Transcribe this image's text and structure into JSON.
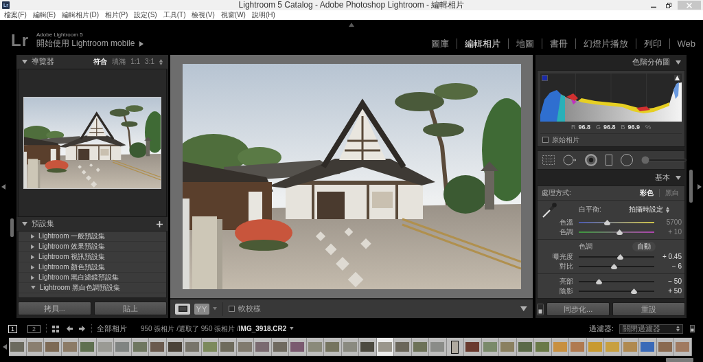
{
  "window": {
    "app_icon": "Lr",
    "title": "Lightroom 5 Catalog - Adobe Photoshop Lightroom - 編輯相片"
  },
  "menu": [
    "檔案(F)",
    "編輯(E)",
    "編輯相片(D)",
    "相片(P)",
    "設定(S)",
    "工具(T)",
    "檢視(V)",
    "視窗(W)",
    "說明(H)"
  ],
  "identity": {
    "logo": "Lr",
    "product": "Adobe Lightroom 5",
    "promo": "開始使用 Lightroom mobile"
  },
  "modules": [
    {
      "label": "圖庫",
      "selected": false
    },
    {
      "label": "編輯相片",
      "selected": true
    },
    {
      "label": "地圖",
      "selected": false
    },
    {
      "label": "書冊",
      "selected": false
    },
    {
      "label": "幻燈片播放",
      "selected": false
    },
    {
      "label": "列印",
      "selected": false
    },
    {
      "label": "Web",
      "selected": false
    }
  ],
  "navigator": {
    "title": "導覽器",
    "expanded": true,
    "zoom_options": [
      {
        "label": "符合",
        "selected": true
      },
      {
        "label": "填滿",
        "selected": false
      },
      {
        "label": "1:1",
        "selected": false
      },
      {
        "label": "3:1",
        "selected": false
      }
    ]
  },
  "presets": {
    "title": "預設集",
    "expanded": true,
    "items": [
      {
        "label": "Lightroom 一般預設集",
        "expanded": false
      },
      {
        "label": "Lightroom 效果預設集",
        "expanded": false
      },
      {
        "label": "Lightroom 視訊預設集",
        "expanded": false
      },
      {
        "label": "Lightroom 顏色預設集",
        "expanded": false
      },
      {
        "label": "Lightroom 黑白濾鏡預設集",
        "expanded": false
      },
      {
        "label": "Lightroom 黑白色調預設集",
        "expanded": true
      }
    ]
  },
  "left_buttons": [
    "拷貝...",
    "貼上"
  ],
  "toolbar": {
    "compare": "YY",
    "soft_proofing": {
      "label": "軟校樣",
      "checked": false
    }
  },
  "histogram": {
    "title": "色階分佈圖",
    "expanded": true,
    "readout": [
      {
        "label": "R",
        "value": "96.8"
      },
      {
        "label": "G",
        "value": "96.8"
      },
      {
        "label": "B",
        "value": "96.9"
      }
    ],
    "unit": "%",
    "original_photo": {
      "label": "原始相片",
      "checked": false
    }
  },
  "basic": {
    "title": "基本",
    "expanded": true,
    "treatment": {
      "label": "處理方式:",
      "options": [
        {
          "label": "彩色",
          "selected": true
        },
        {
          "label": "黑白",
          "selected": false
        }
      ]
    },
    "white_balance": {
      "label": "白平衡:",
      "value": "拍攝時設定"
    },
    "wb_sliders": [
      {
        "label": "色溫",
        "kind": "temperature",
        "level": 0.38,
        "reading": "5700"
      },
      {
        "label": "色調",
        "kind": "tint",
        "level": 0.54,
        "reading": "+ 10"
      }
    ],
    "tone": {
      "label": "色調",
      "auto": "自動"
    },
    "tone_sliders": [
      {
        "label": "曝光度",
        "kind": "plain",
        "level": 0.55,
        "reading": "+ 0.45"
      },
      {
        "label": "對比",
        "kind": "plain",
        "level": 0.47,
        "reading": "− 6"
      }
    ],
    "presence_sliders": [
      {
        "label": "亮部",
        "kind": "plain",
        "level": 0.27,
        "reading": "− 50"
      },
      {
        "label": "陰影",
        "kind": "plain",
        "level": 0.73,
        "reading": "+ 50"
      }
    ]
  },
  "right_buttons": [
    "同步化...",
    "重設"
  ],
  "filmstrip_bar": {
    "monitors": [
      {
        "label": "1",
        "selected": true
      },
      {
        "label": "2",
        "selected": false
      }
    ],
    "source": "全部相片",
    "info": "950 張相片 /選取了 950 張相片 /**IMG_3918.CR2**",
    "filter_label": "過濾器:",
    "filter_value": "關閉過濾器"
  },
  "filmstrip": [
    {
      "kind": "landscape",
      "active": false
    },
    {
      "kind": "landscape",
      "active": false
    },
    {
      "kind": "landscape",
      "active": false
    },
    {
      "kind": "landscape",
      "active": false
    },
    {
      "kind": "landscape",
      "active": false
    },
    {
      "kind": "landscape",
      "active": false
    },
    {
      "kind": "landscape",
      "active": false
    },
    {
      "kind": "landscape",
      "active": false
    },
    {
      "kind": "landscape",
      "active": false
    },
    {
      "kind": "landscape",
      "active": false
    },
    {
      "kind": "landscape",
      "active": false
    },
    {
      "kind": "landscape",
      "active": false
    },
    {
      "kind": "landscape",
      "active": false
    },
    {
      "kind": "landscape",
      "active": false
    },
    {
      "kind": "landscape",
      "active": false
    },
    {
      "kind": "landscape",
      "active": false
    },
    {
      "kind": "landscape",
      "active": false
    },
    {
      "kind": "landscape",
      "active": false
    },
    {
      "kind": "landscape",
      "active": false
    },
    {
      "kind": "landscape",
      "active": false
    },
    {
      "kind": "landscape",
      "active": false
    },
    {
      "kind": "landscape",
      "active": true
    },
    {
      "kind": "landscape",
      "active": false
    },
    {
      "kind": "landscape",
      "active": false
    },
    {
      "kind": "landscape",
      "active": false
    },
    {
      "kind": "portrait",
      "active": false
    },
    {
      "kind": "landscape",
      "active": false
    },
    {
      "kind": "landscape",
      "active": false
    },
    {
      "kind": "landscape",
      "active": false
    },
    {
      "kind": "landscape",
      "active": false
    },
    {
      "kind": "landscape",
      "active": false
    },
    {
      "kind": "landscape",
      "active": false
    },
    {
      "kind": "landscape",
      "active": false
    },
    {
      "kind": "landscape",
      "active": false
    },
    {
      "kind": "landscape",
      "active": false
    },
    {
      "kind": "landscape",
      "active": false
    },
    {
      "kind": "landscape",
      "active": false
    },
    {
      "kind": "landscape",
      "active": false
    },
    {
      "kind": "landscape",
      "active": false
    }
  ]
}
